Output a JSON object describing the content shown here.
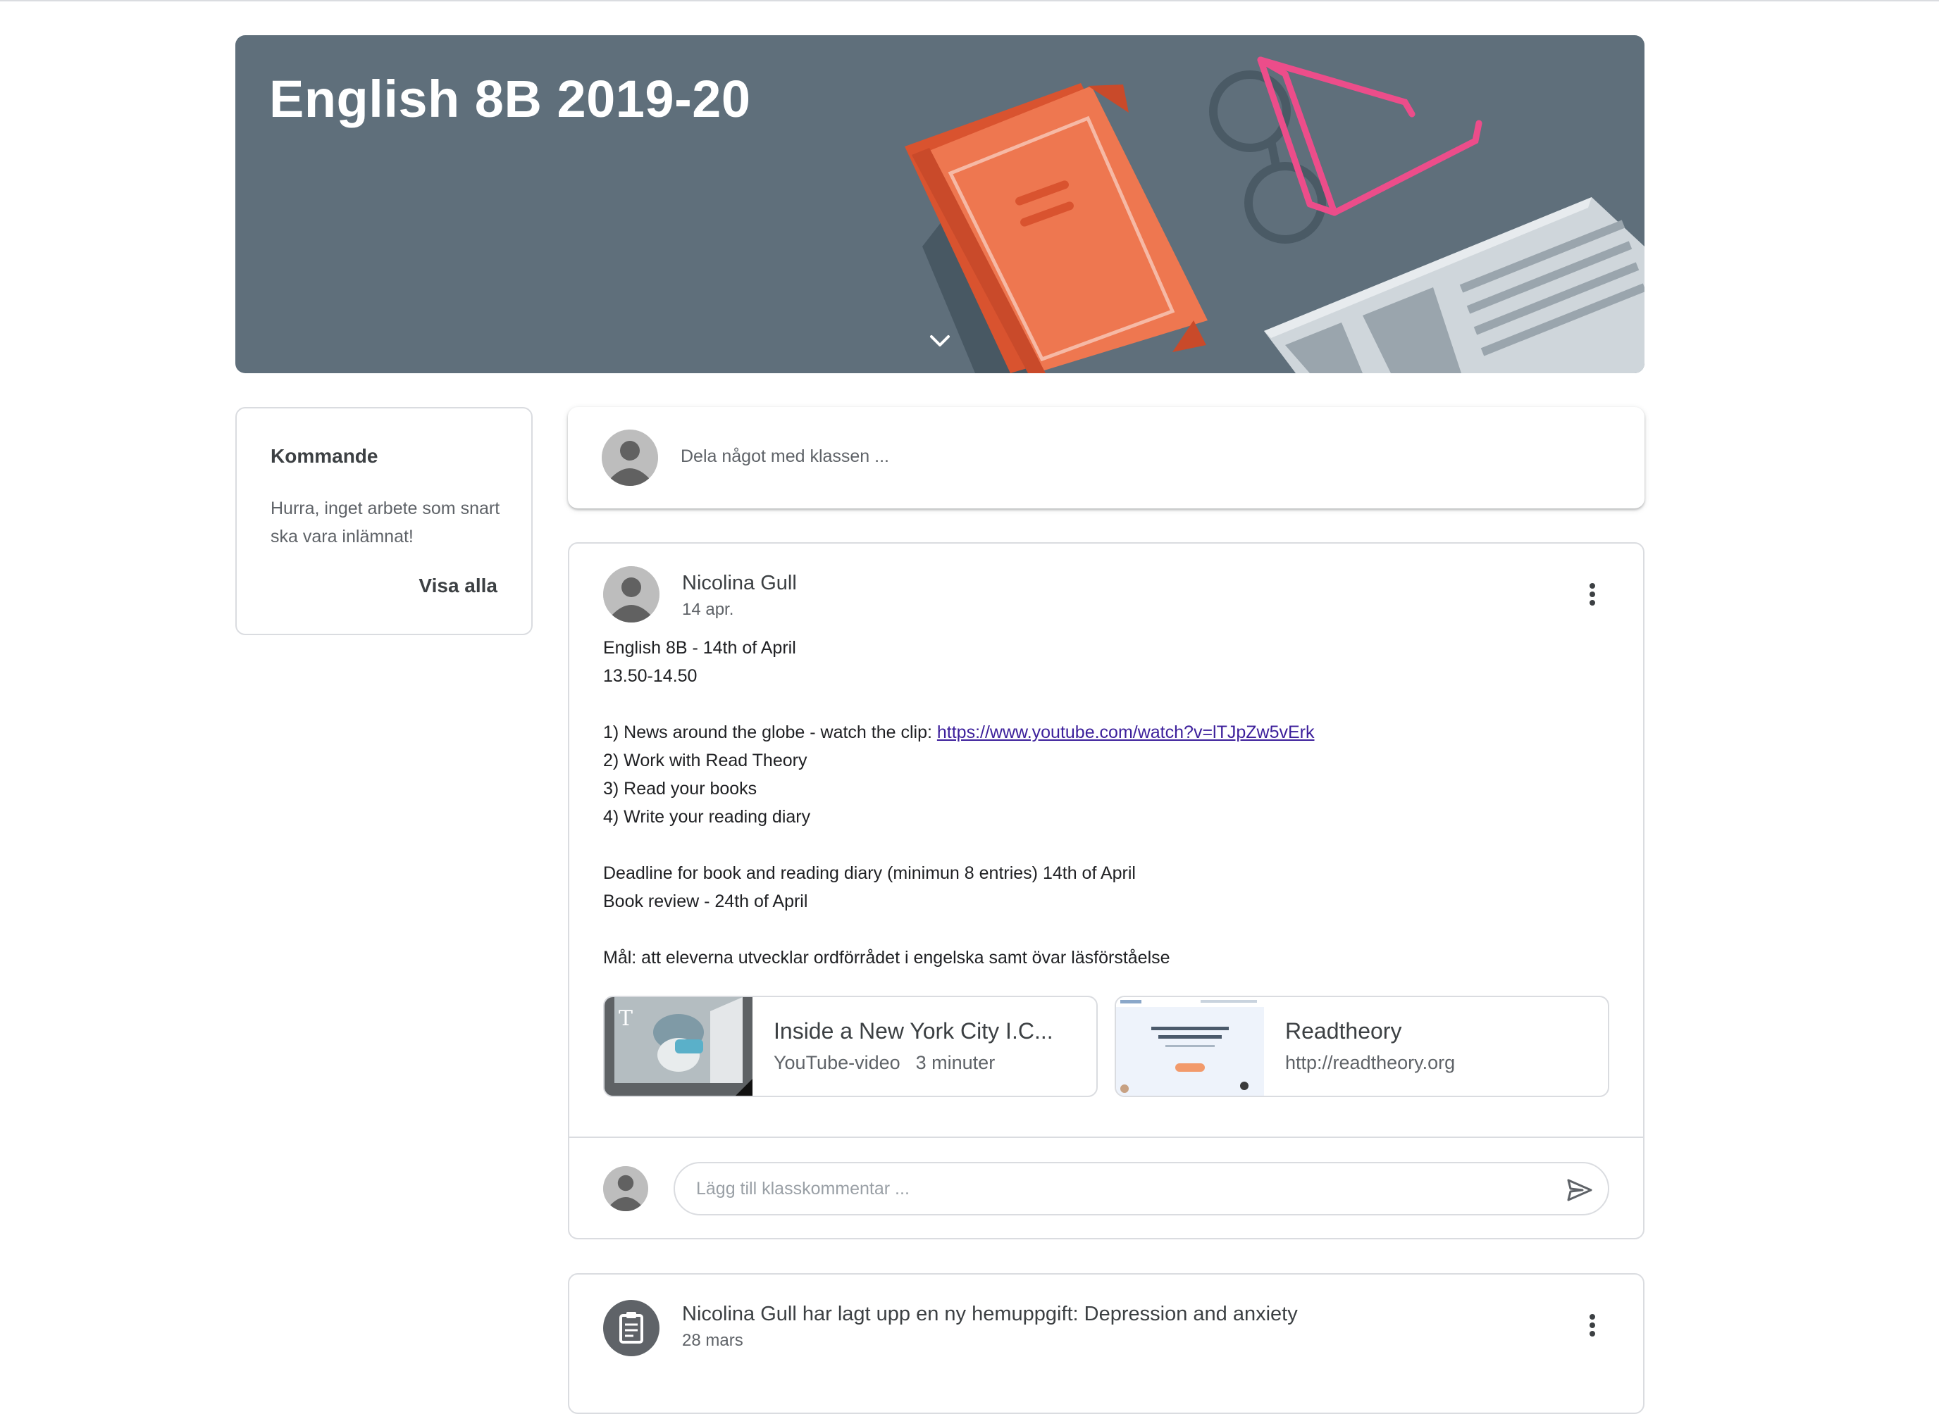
{
  "banner": {
    "title": "English 8B 2019-20"
  },
  "upcoming": {
    "title": "Kommande",
    "message": "Hurra, inget arbete som snart ska vara inlämnat!",
    "view_all": "Visa alla"
  },
  "share": {
    "placeholder": "Dela något med klassen ..."
  },
  "post": {
    "author": "Nicolina Gull",
    "date": "14 apr.",
    "lines": {
      "l1": "English 8B - 14th of April",
      "l2": "13.50-14.50",
      "l3_prefix": "1) News around the globe - watch the clip: ",
      "l3_link": "https://www.youtube.com/watch?v=lTJpZw5vErk",
      "l4": "2) Work with Read Theory",
      "l5": "3) Read your books",
      "l6": "4) Write your reading diary",
      "l7": "Deadline for book and reading diary (minimun 8 entries) 14th of April",
      "l8": "Book review - 24th of April",
      "l9": "Mål: att eleverna utvecklar ordförrådet i engelska samt övar läsförståelse"
    },
    "attachments": [
      {
        "title": "Inside a New York City I.C...",
        "type": "YouTube-video",
        "duration": "3 minuter"
      },
      {
        "title": "Readtheory",
        "url": "http://readtheory.org"
      }
    ],
    "comment_placeholder": "Lägg till klasskommentar ..."
  },
  "post2": {
    "title": "Nicolina Gull har lagt upp en ny hemuppgift: Depression and anxiety",
    "date": "28 mars"
  },
  "icons": {
    "avatar": "person-avatar-icon",
    "menu": "more-vert-icon",
    "send": "send-icon",
    "assignment": "assignment-icon",
    "expand": "chevron-down-icon"
  },
  "colors": {
    "banner_bg": "#5f6f7b",
    "book": "#ee7750",
    "glasses": "#ec4d8a",
    "link": "#3c1f9b"
  }
}
